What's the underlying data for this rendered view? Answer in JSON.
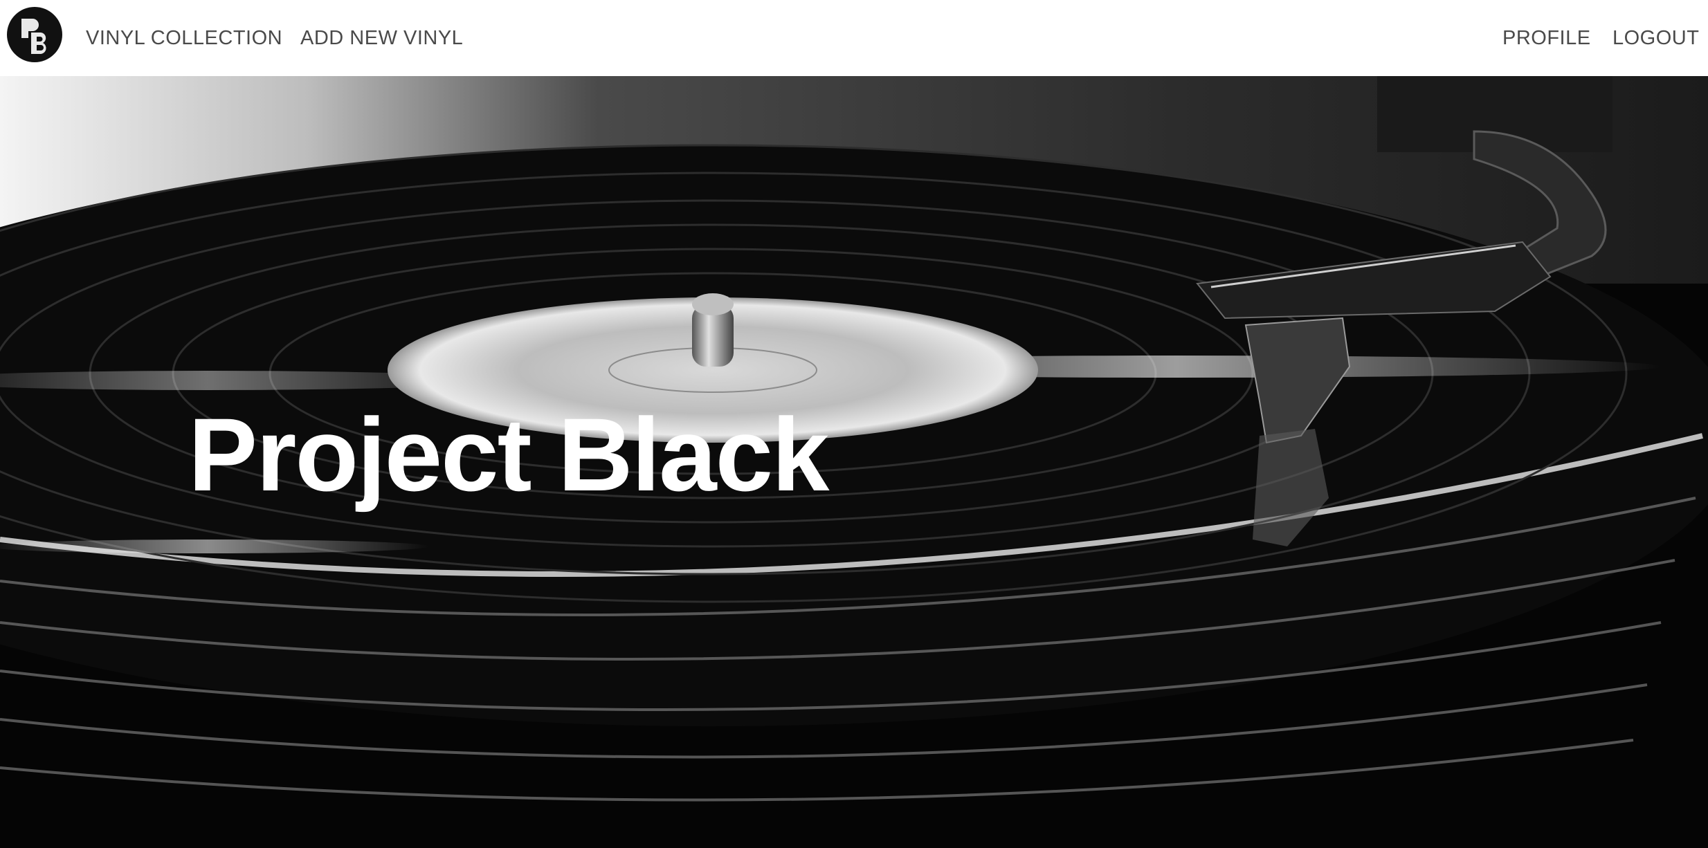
{
  "navbar": {
    "logo_icon": "pb-logo-icon",
    "links_left": [
      {
        "label": "VINYL COLLECTION"
      },
      {
        "label": "ADD NEW VINYL"
      }
    ],
    "links_right": [
      {
        "label": "PROFILE"
      },
      {
        "label": "LOGOUT"
      }
    ]
  },
  "hero": {
    "title": "Project Black",
    "background_icon": "turntable-record-photo",
    "colors": {
      "text": "#ffffff",
      "background": "#0a0a0a"
    }
  }
}
